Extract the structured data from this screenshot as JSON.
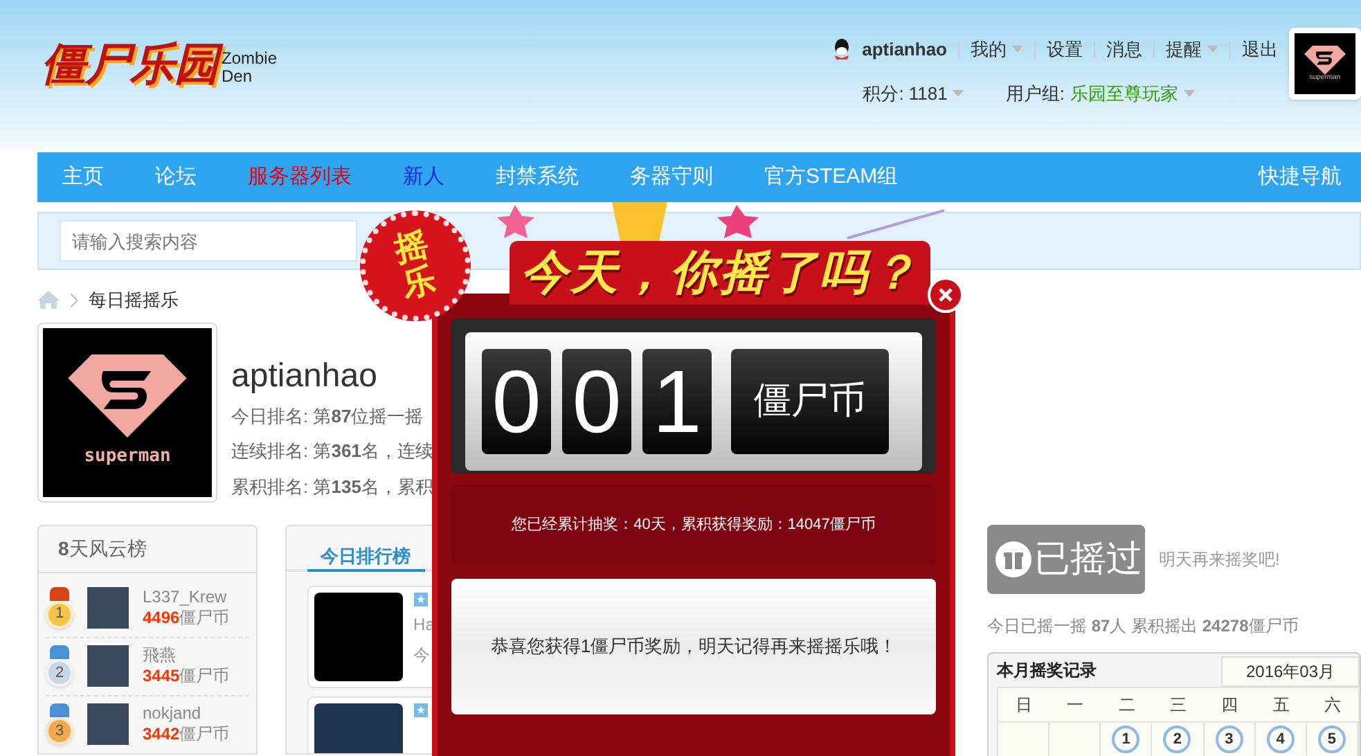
{
  "logo": {
    "title": "僵尸乐园",
    "subtitle": "Zombie Den"
  },
  "user_bar": {
    "username": "aptianhao",
    "links": [
      {
        "label": "我的",
        "dropdown": true
      },
      {
        "label": "设置",
        "dropdown": false
      },
      {
        "label": "消息",
        "dropdown": false
      },
      {
        "label": "提醒",
        "dropdown": true
      },
      {
        "label": "退出",
        "dropdown": false
      }
    ],
    "points_label": "积分: 1181",
    "group_label": "用户组:",
    "group_value": "乐园至尊玩家",
    "avatar_caption": "superman"
  },
  "nav": {
    "items": [
      {
        "label": "主页",
        "kind": "normal"
      },
      {
        "label": "论坛",
        "kind": "normal"
      },
      {
        "label": "服务器列表",
        "kind": "hot"
      },
      {
        "label": "新人",
        "kind": "new"
      },
      {
        "label": "封禁系统",
        "kind": "normal"
      },
      {
        "label": "务器守则",
        "kind": "normal"
      },
      {
        "label": "官方STEAM组",
        "kind": "normal"
      }
    ],
    "right": "快捷导航"
  },
  "search": {
    "placeholder": "请输入搜索内容"
  },
  "breadcrumb": [
    "每日摇摇乐"
  ],
  "profile": {
    "avatar_caption": "superman",
    "username": "aptianhao",
    "lines": [
      "今日排名: 第**87**位摇一摇",
      "连续排名: 第**361**名，连续",
      "累积排名: 第**135**名，累积"
    ]
  },
  "leaderboard": {
    "title": "**8**天风云榜",
    "entries": [
      {
        "rank": "1",
        "name": "L337_Krew",
        "coins": "4496",
        "unit": "僵尸币"
      },
      {
        "rank": "2",
        "name": "飛燕",
        "coins": "3445",
        "unit": "僵尸币"
      },
      {
        "rank": "3",
        "name": "nokjand",
        "coins": "3442",
        "unit": "僵尸币"
      }
    ]
  },
  "today_rank": {
    "tabs": [
      {
        "label": "今日排行榜",
        "selected": true
      }
    ],
    "cards": [
      {
        "starred": true,
        "line_1": "Ha",
        "line_2": "今"
      },
      {
        "starred": true
      }
    ]
  },
  "shake": {
    "button": "已摇过",
    "disabled": true,
    "hint": "明天再来摇奖吧!",
    "stats": "今日已摇一摇 **87**人 累积摇出 **24278**僵尸币"
  },
  "calendar": {
    "title": "本月摇奖记录",
    "month": "2016年03月",
    "weekdays": [
      "日",
      "一",
      "二",
      "三",
      "四",
      "五",
      "六"
    ],
    "days": [
      "1",
      "2",
      "3",
      "4",
      "5"
    ]
  },
  "popup": {
    "badge": "摇乐",
    "title": "今天，你摇了吗？",
    "digits": [
      "0",
      "0",
      "1"
    ],
    "unit": "僵尸币",
    "summary": "您已经累计抽奖：40天，累积获得奖励：14047僵尸币",
    "message": "恭喜您获得1僵尸币奖励，明天记得再来摇摇乐哦！"
  }
}
